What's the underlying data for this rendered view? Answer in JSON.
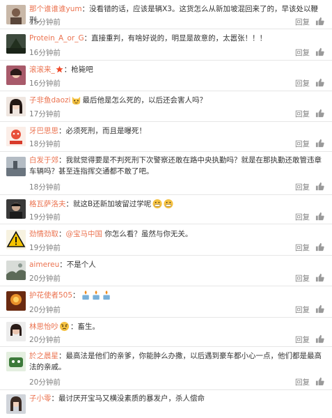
{
  "comments": [
    {
      "user": "那个谁谁谁yum",
      "text": "：没看错的话，应该是辆X3。这货怎么从新加坡混回来了的，早该处以鞭刑。",
      "time": "15分钟前",
      "reply": "回复"
    },
    {
      "user": "Protein_A_or_G",
      "text": "：直接重判，有啥好说的，明显是故意的，太嚣张！！！",
      "time": "16分钟前",
      "reply": "回复"
    },
    {
      "user": "滚滚来_",
      "text": "：枪毙吧",
      "time": "16分钟前",
      "reply": "回复",
      "badge": "star-badge-icon"
    },
    {
      "user": "子非鱼daozi",
      "text": "最后他是怎么死的，以后还会害人吗？",
      "time": "17分钟前",
      "reply": "回复",
      "emoji": "cat-face-emoji"
    },
    {
      "user": "牙巴思思",
      "text": "：必须死刑，而且是曝死！",
      "time": "18分钟前",
      "reply": "回复"
    },
    {
      "user": "白发于郊",
      "text": "：我就觉得要是不判死刑下次警察还敢在路中央执勤吗？就是在那执勤还敢管违章车辆吗？甚至连指挥交通都不敢了吧。",
      "time": "18分钟前",
      "reply": "回复"
    },
    {
      "user": "格瓦萨洛夫",
      "text": "：就这B还新加坡留过学呢",
      "time": "19分钟前",
      "reply": "回复",
      "emoji": "grimace-emoji-pair"
    },
    {
      "user": "劲情劲取",
      "text_pre": "：",
      "link": "@宝马中国",
      "text": " 你怎么看？虽然与你无关。",
      "time": "19分钟前",
      "reply": "回复"
    },
    {
      "user": "aimereu",
      "text": "：不是个人",
      "time": "20分钟前",
      "reply": "回复"
    },
    {
      "user": "护花使者505",
      "text": "：",
      "time": "20分钟前",
      "reply": "回复",
      "emoji": "candle-emoji-triple"
    },
    {
      "user": "林思怡吵",
      "text": "：畜生。",
      "time": "20分钟前",
      "reply": "回复",
      "emoji": "angry-emoji"
    },
    {
      "user": "於之晨星",
      "text": "：最高法是他们的亲爹，你能肿么办撒，以后遇到豪车都小心一点，他们都是最高法的亲戚。",
      "time": "20分钟前",
      "reply": "回复"
    },
    {
      "user": "子小零",
      "text": "：最讨厌开宝马又横没素质的暴发户，杀人偿命",
      "time": "",
      "reply": ""
    }
  ],
  "colors": {
    "name": "#eb7350",
    "meta": "#808080",
    "text": "#333333",
    "divider": "#e6e6e6"
  },
  "icons": {
    "like": "thumbs-up-icon",
    "star": "star-badge-icon"
  }
}
